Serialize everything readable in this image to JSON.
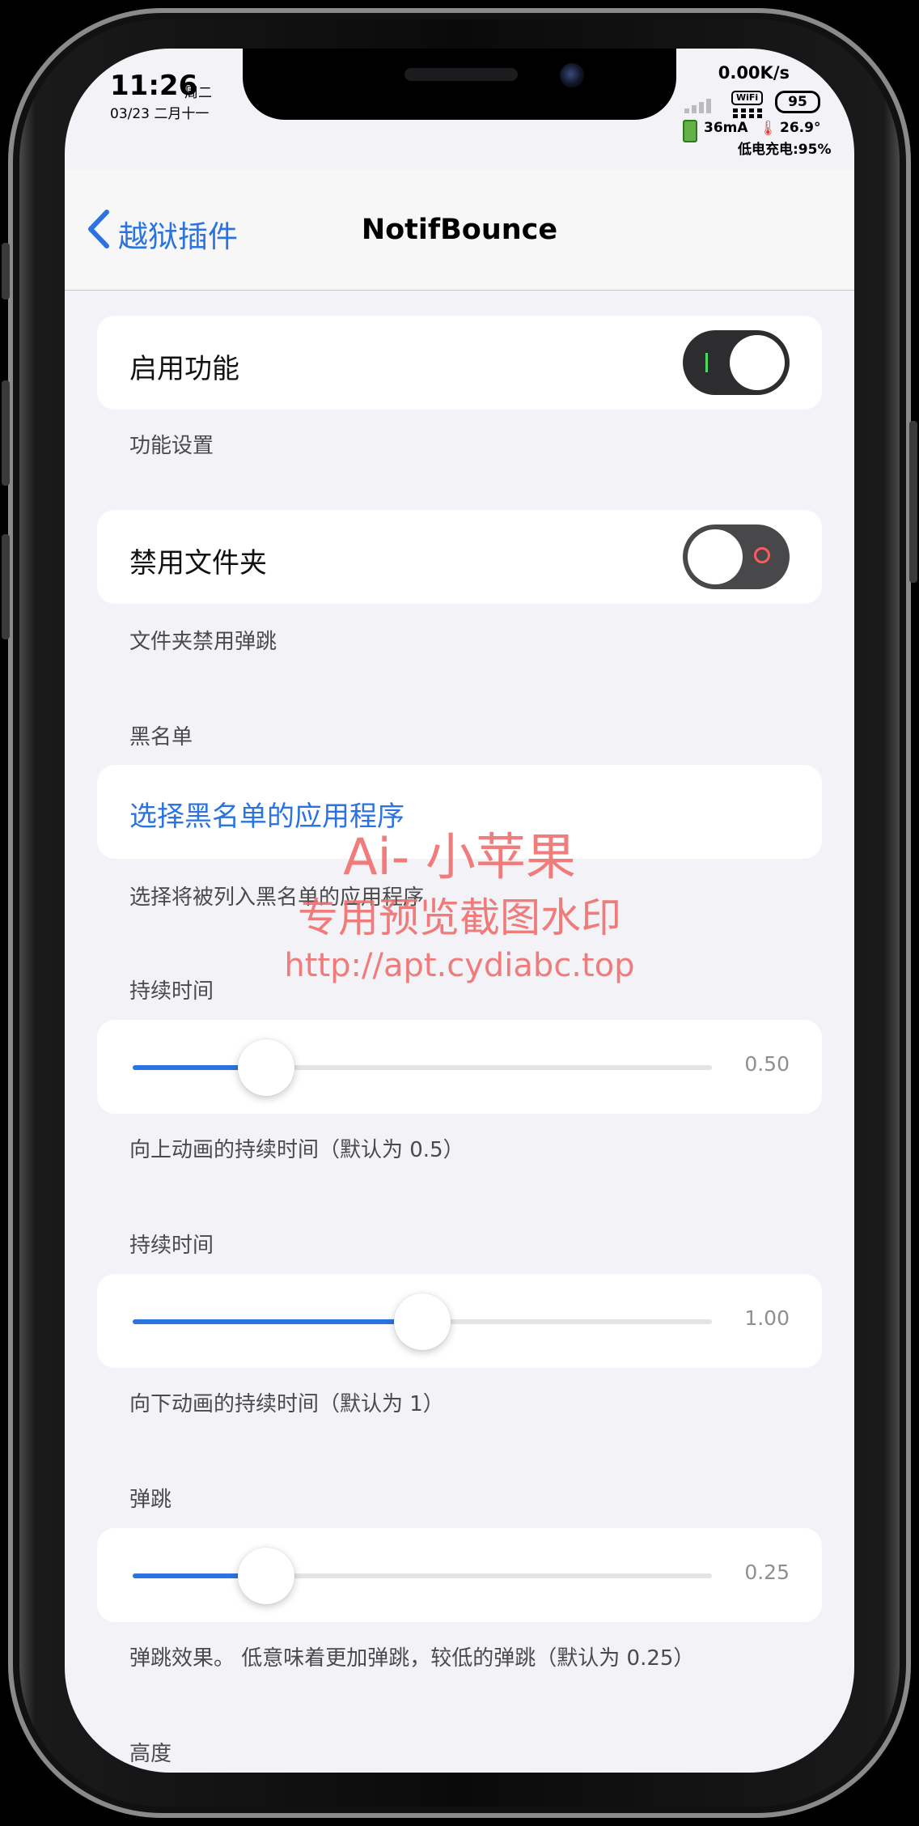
{
  "status_bar": {
    "time": "11:26",
    "weekday": "周二",
    "date": "03/23 二月十一",
    "net_speed": "0.00K/s",
    "wifi": "WiFi",
    "battery": "95",
    "current": "36mA",
    "temperature": "26.9°",
    "charge_status": "低电充电:95%"
  },
  "navbar": {
    "back_label": "越狱插件",
    "title": "NotifBounce"
  },
  "sections": {
    "enable": {
      "label": "启用功能",
      "on": true,
      "footer": "功能设置"
    },
    "folders": {
      "label": "禁用文件夹",
      "on": false,
      "footer": "文件夹禁用弹跳"
    },
    "blacklist": {
      "header": "黑名单",
      "link": "选择黑名单的应用程序",
      "footer": "选择将被列入黑名单的应用程序"
    },
    "up_duration": {
      "header": "持续时间",
      "value": 0.5,
      "value_text": "0.50",
      "fraction": 0.23,
      "footer": "向上动画的持续时间（默认为 0.5）"
    },
    "down_duration": {
      "header": "持续时间",
      "value": 1.0,
      "value_text": "1.00",
      "fraction": 0.5,
      "footer": "向下动画的持续时间（默认为 1）"
    },
    "bounce": {
      "header": "弹跳",
      "value": 0.25,
      "value_text": "0.25",
      "fraction": 0.23,
      "footer": "弹跳效果。 低意味着更加弹跳，较低的弹跳（默认为 0.25）"
    },
    "height": {
      "header": "高度"
    }
  },
  "watermark": {
    "line1": "Ai- 小苹果",
    "line2": "专用预览截图水印",
    "line3": "http://apt.cydiabc.top"
  },
  "colors": {
    "accent": "#2a73e0",
    "background": "#f2f2f7",
    "watermark": "#f06b6b"
  }
}
